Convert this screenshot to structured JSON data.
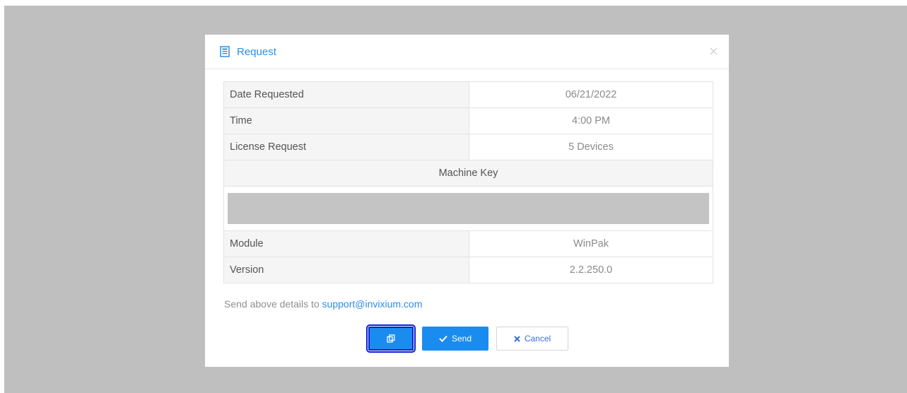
{
  "modal": {
    "title": "Request",
    "title_icon": "document-icon",
    "close_icon": "close-icon"
  },
  "details": {
    "rows": [
      {
        "label": "Date Requested",
        "value": "06/21/2022"
      },
      {
        "label": "Time",
        "value": "4:00 PM"
      },
      {
        "label": "License Request",
        "value": "5 Devices"
      }
    ],
    "machine_key_label": "Machine Key",
    "machine_key_value": "",
    "rows_after": [
      {
        "label": "Module",
        "value": "WinPak"
      },
      {
        "label": "Version",
        "value": "2.2.250.0"
      }
    ]
  },
  "note": {
    "text": "Send above details to ",
    "email": "support@invixium.com"
  },
  "buttons": {
    "copy_icon": "copy-icon",
    "send_label": "Send",
    "send_icon": "check-icon",
    "cancel_label": "Cancel",
    "cancel_icon": "x-icon"
  },
  "colors": {
    "accent": "#1a8cf0",
    "link": "#2a8ee8",
    "backdrop": "#bfbfbf",
    "highlight": "#0a1fd0"
  }
}
